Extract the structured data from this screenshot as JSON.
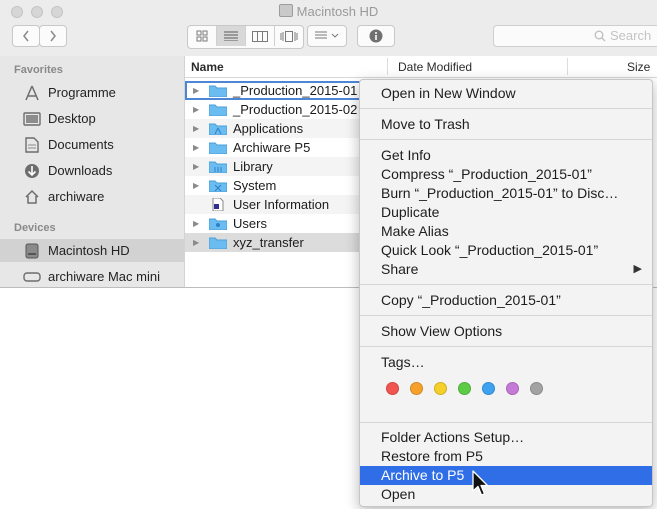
{
  "window": {
    "title": "Macintosh HD",
    "search_placeholder": "Search"
  },
  "sidebar": {
    "favorites_heading": "Favorites",
    "favorites": [
      "Programme",
      "Desktop",
      "Documents",
      "Downloads",
      "archiware"
    ],
    "devices_heading": "Devices",
    "devices": [
      "Macintosh HD",
      "archiware Mac mini"
    ]
  },
  "columns": {
    "name": "Name",
    "date_modified": "Date Modified",
    "size": "Size"
  },
  "files": [
    "_Production_2015-01",
    "_Production_2015-02",
    "Applications",
    "Archiware P5",
    "Library",
    "System",
    "User Information",
    "Users",
    "xyz_transfer"
  ],
  "menu": {
    "open_new_window": "Open in New Window",
    "move_to_trash": "Move to Trash",
    "get_info": "Get Info",
    "compress": "Compress “_Production_2015-01”",
    "burn": "Burn “_Production_2015-01” to Disc…",
    "duplicate": "Duplicate",
    "make_alias": "Make Alias",
    "quick_look": "Quick Look “_Production_2015-01”",
    "share": "Share",
    "copy": "Copy “_Production_2015-01”",
    "show_view_options": "Show View Options",
    "tags": "Tags…",
    "tag_colors": [
      "#f2544f",
      "#f5a12a",
      "#f5cf2a",
      "#5ecb46",
      "#3ea2f0",
      "#c57ad8",
      "#a3a3a3"
    ],
    "folder_actions_setup": "Folder Actions Setup…",
    "restore_from_p5": "Restore from P5",
    "archive_to_p5": "Archive to P5",
    "open": "Open"
  },
  "colors": {
    "selection": "#2f6ee6",
    "folder": "#6bbcf0"
  }
}
